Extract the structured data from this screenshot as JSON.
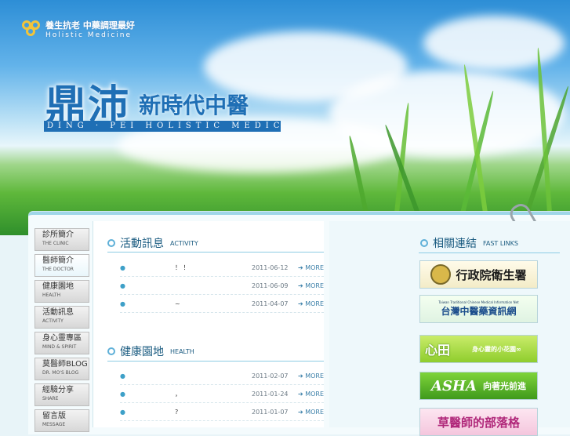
{
  "header": {
    "slogan": "養生抗老 中藥調理最好",
    "slogan_en": "Holistic Medicine",
    "brand_big": "鼎沛",
    "brand_small": "新時代中醫",
    "brand_en": "DING · PEI HOLISTIC MEDICINE"
  },
  "nav": {
    "items": [
      {
        "zh": "診所簡介",
        "en": "THE CLINIC"
      },
      {
        "zh": "醫師簡介",
        "en": "THE DOCTOR"
      },
      {
        "zh": "健康園地",
        "en": "HEALTH"
      },
      {
        "zh": "活動訊息",
        "en": "ACTIVITY"
      },
      {
        "zh": "身心靈專區",
        "en": "MIND & SPIRIT"
      },
      {
        "zh": "莫醫師BLOG",
        "en": "DR. MO'S BLOG"
      },
      {
        "zh": "經驗分享",
        "en": "SHARE"
      },
      {
        "zh": "留言版",
        "en": "MESSAGE"
      }
    ]
  },
  "activity": {
    "title_zh": "活動訊息",
    "title_en": "ACTIVITY",
    "rows": [
      {
        "title": "！ ！",
        "date": "2011-06-12",
        "more": "MORE"
      },
      {
        "title": "",
        "date": "2011-06-09",
        "more": "MORE"
      },
      {
        "title": "~",
        "date": "2011-04-07",
        "more": "MORE"
      }
    ]
  },
  "health": {
    "title_zh": "健康園地",
    "title_en": "HEALTH",
    "rows": [
      {
        "title": "",
        "date": "2011-02-07",
        "more": "MORE"
      },
      {
        "title": "，",
        "date": "2011-01-24",
        "more": "MORE"
      },
      {
        "title": "?",
        "date": "2011-01-07",
        "more": "MORE"
      }
    ]
  },
  "links": {
    "title_zh": "相關連結",
    "title_en": "FAST LINKS",
    "banners": [
      {
        "text": "行政院衛生署",
        "sub": ""
      },
      {
        "text": "台灣中醫藥資訊網",
        "sub": "Taiwan Traditional Chinese Medical Information Net"
      },
      {
        "text": "心田",
        "sub": "身心靈的小花園∞"
      },
      {
        "text": "ASHA",
        "sub": "向著光前進"
      },
      {
        "text": "草醫師的部落格",
        "sub": ""
      }
    ]
  },
  "colors": {
    "accent": "#1f6fb5",
    "link": "#3a7fa8"
  }
}
